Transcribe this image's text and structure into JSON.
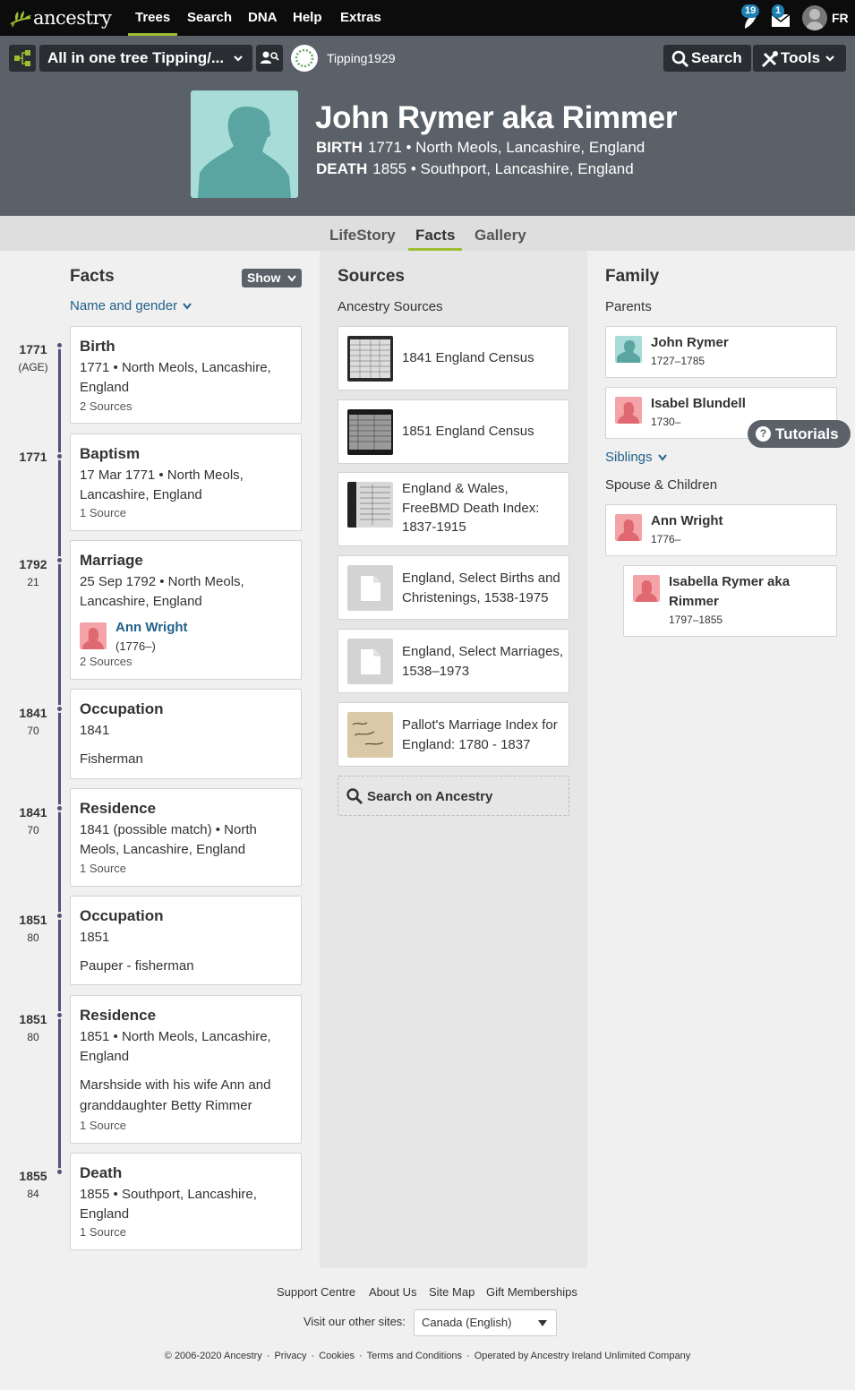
{
  "nav": {
    "brand": "ancestry",
    "items": [
      "Trees",
      "Search",
      "DNA",
      "Help",
      "Extras"
    ],
    "active_item": "Trees",
    "hints_count": "19",
    "messages_count": "1",
    "user_initials": "FR"
  },
  "toolbar": {
    "tree_name": "All in one tree Tipping/...",
    "tree_owner": "Tipping1929",
    "search_label": "Search",
    "tools_label": "Tools"
  },
  "person": {
    "name": "John Rymer aka Rimmer",
    "birth_label": "BIRTH",
    "birth_value": "1771 • North Meols, Lancashire, England",
    "death_label": "DEATH",
    "death_value": "1855 • Southport, Lancashire, England"
  },
  "tabs": [
    "LifeStory",
    "Facts",
    "Gallery"
  ],
  "active_tab": "Facts",
  "facts": {
    "heading": "Facts",
    "show_label": "Show",
    "name_gender_link": "Name and gender",
    "items": [
      {
        "year": "1771",
        "age": "(AGE)",
        "title": "Birth",
        "detail": "1771 • North Meols, Lancashire, England",
        "sources": "2 Sources"
      },
      {
        "year": "1771",
        "age": "",
        "title": "Baptism",
        "detail": "17 Mar 1771 • North Meols, Lancashire, England",
        "sources": "1 Source"
      },
      {
        "year": "1792",
        "age": "21",
        "title": "Marriage",
        "detail": "25 Sep 1792 • North Meols, Lancashire, England",
        "spouse_name": "Ann Wright",
        "spouse_years": "(1776–)",
        "sources": "2 Sources"
      },
      {
        "year": "1841",
        "age": "70",
        "title": "Occupation",
        "detail": "1841",
        "note": "Fisherman",
        "sources": ""
      },
      {
        "year": "1841",
        "age": "70",
        "title": "Residence",
        "detail": "1841 (possible match) • North Meols, Lancashire, England",
        "sources": "1 Source"
      },
      {
        "year": "1851",
        "age": "80",
        "title": "Occupation",
        "detail": "1851",
        "note": "Pauper - fisherman",
        "sources": ""
      },
      {
        "year": "1851",
        "age": "80",
        "title": "Residence",
        "detail": "1851 • North Meols, Lancashire, England",
        "note": "Marshside with his wife Ann and granddaughter Betty Rimmer",
        "sources": "1 Source"
      },
      {
        "year": "1855",
        "age": "84",
        "title": "Death",
        "detail": "1855 • Southport, Lancashire, England",
        "sources": "1 Source"
      }
    ]
  },
  "sources": {
    "heading": "Sources",
    "subheading": "Ancestry Sources",
    "items": [
      {
        "title": "1841 England Census",
        "thumb": "census-page"
      },
      {
        "title": "1851 England Census",
        "thumb": "census-page-dark"
      },
      {
        "title": "England & Wales, FreeBMD Death Index: 1837-1915",
        "thumb": "index-page"
      },
      {
        "title": "England, Select Births and Christenings, 1538-1975",
        "thumb": "document-icon"
      },
      {
        "title": "England, Select Marriages, 1538–1973",
        "thumb": "document-icon"
      },
      {
        "title": "Pallot's Marriage Index for England: 1780 - 1837",
        "thumb": "handwritten-card"
      }
    ],
    "search_label": "Search on Ancestry"
  },
  "family": {
    "heading": "Family",
    "parents_label": "Parents",
    "parents": [
      {
        "name": "John Rymer",
        "years": "1727–1785",
        "gender": "male"
      },
      {
        "name": "Isabel Blundell",
        "years": "1730–",
        "gender": "female"
      }
    ],
    "siblings_label": "Siblings",
    "spouse_children_label": "Spouse & Children",
    "spouse": {
      "name": "Ann Wright",
      "years": "1776–",
      "gender": "female"
    },
    "children": [
      {
        "name": "Isabella Rymer aka Rimmer",
        "years": "1797–1855",
        "gender": "female"
      }
    ],
    "tutorials_label": "Tutorials"
  },
  "footer": {
    "links": [
      "Support Centre",
      "About Us",
      "Site Map",
      "Gift Memberships"
    ],
    "visit_label": "Visit our other sites:",
    "site_select": "Canada (English)",
    "copyright": "© 2006-2020 Ancestry",
    "legal": [
      "Privacy",
      "Cookies",
      "Terms and Conditions",
      "Operated by Ancestry Ireland Unlimited Company"
    ]
  },
  "colors": {
    "nav_bg": "#0c0c0c",
    "header_bg": "#5b6168",
    "accent_green": "#9cbe30",
    "link_blue": "#23618a",
    "male_bg": "#a8dcd8",
    "female_bg": "#f4a4a8",
    "timeline": "#53507a"
  }
}
